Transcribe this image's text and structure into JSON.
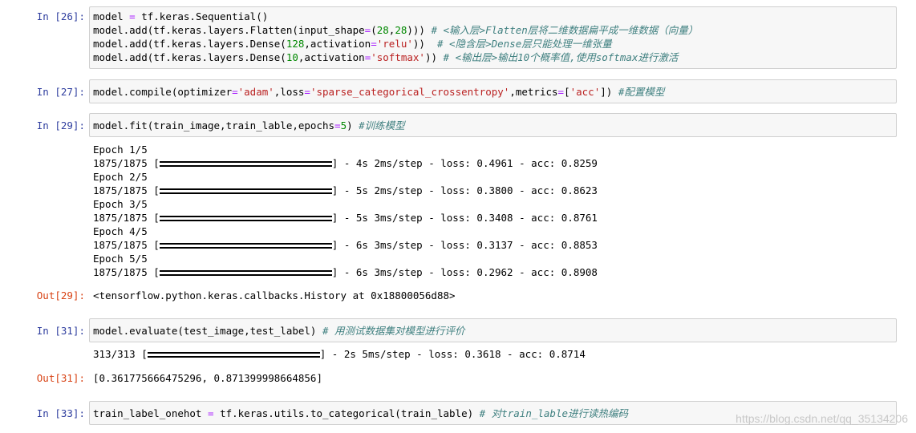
{
  "cells": [
    {
      "prompt": "In  [26]:",
      "lines": [
        [
          "model ",
          "= ",
          "tf.keras.Sequential()",
          "",
          ""
        ],
        [
          "model.add(tf.keras.layers.Flatten(input_shape",
          "=",
          "(",
          "28",
          ",",
          "28",
          "))) ",
          "# <输入层>Flatten层将二维数据扁平成一维数据（向量）"
        ],
        [
          "model.add(tf.keras.layers.Dense(",
          "128",
          ",activation",
          "=",
          "'relu'",
          "))  ",
          "# <隐含层>Dense层只能处理一维张量"
        ],
        [
          "model.add(tf.keras.layers.Dense(",
          "10",
          ",activation",
          "=",
          "'softmax'",
          ")) ",
          "# <输出层>输出10个概率值,使用softmax进行激活"
        ]
      ]
    },
    {
      "prompt": "In  [27]:",
      "code": [
        "model.compile(optimizer",
        "=",
        "'adam'",
        ",loss",
        "=",
        "'sparse_categorical_crossentropy'",
        ",metrics",
        "=",
        "[",
        "'acc'",
        "]) ",
        "#配置模型"
      ]
    },
    {
      "prompt": "In  [29]:",
      "code": [
        "model.fit(train_image,train_lable,epochs",
        "=",
        "5",
        ") ",
        "#训练模型"
      ],
      "stdout": [
        "Epoch 1/5",
        "1875/1875 [",
        "] - 4s 2ms/step - loss: 0.4961 - acc: 0.8259",
        "Epoch 2/5",
        "] - 5s 2ms/step - loss: 0.3800 - acc: 0.8623",
        "Epoch 3/5",
        "] - 5s 3ms/step - loss: 0.3408 - acc: 0.8761",
        "Epoch 4/5",
        "] - 6s 3ms/step - loss: 0.3137 - acc: 0.8853",
        "Epoch 5/5",
        "] - 6s 3ms/step - loss: 0.2962 - acc: 0.8908"
      ],
      "out_prompt": "Out[29]:",
      "result": "<tensorflow.python.keras.callbacks.History at 0x18800056d88>"
    },
    {
      "prompt": "In  [31]:",
      "code": [
        "model.evaluate(test_image,test_label) ",
        "# 用测试数据集对模型进行评价"
      ],
      "stdout_prefix": "313/313 [",
      "stdout_suffix": "] - 2s 5ms/step - loss: 0.3618 - acc: 0.8714",
      "out_prompt": "Out[31]:",
      "result": "[0.361775666475296, 0.871399998664856]"
    },
    {
      "prompt": "In  [33]:",
      "code": [
        "train_label_onehot ",
        "= ",
        "tf.keras.utils.to_categorical(train_lable) ",
        "# 对train_lable进行读热编码"
      ]
    }
  ],
  "epoch_prefix": "1875/1875 [",
  "watermark": "https://blog.csdn.net/qq_35134206"
}
